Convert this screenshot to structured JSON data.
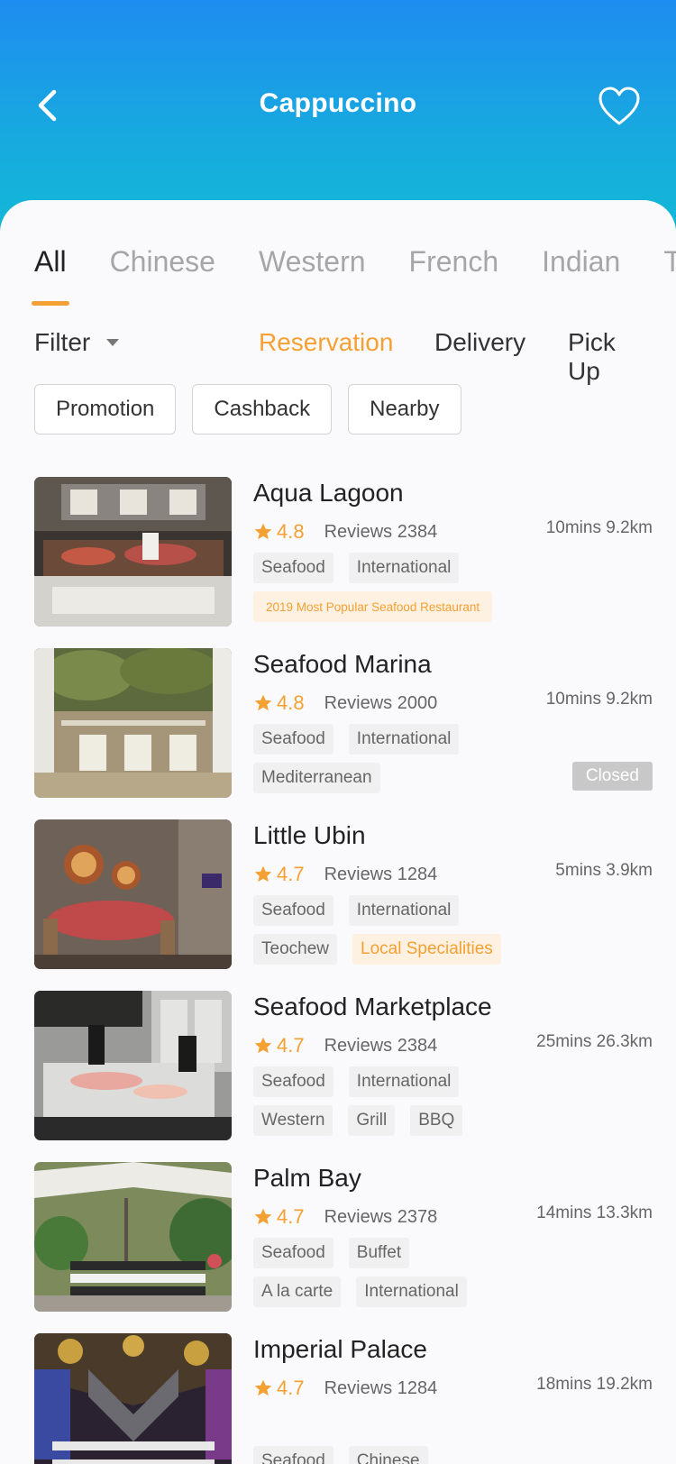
{
  "header": {
    "title": "Cappuccino"
  },
  "tabs": [
    "All",
    "Chinese",
    "Western",
    "French",
    "Indian",
    "Thai"
  ],
  "filter": {
    "label": "Filter"
  },
  "modes": [
    "Reservation",
    "Delivery",
    "Pick Up"
  ],
  "chips": [
    "Promotion",
    "Cashback",
    "Nearby"
  ],
  "restaurants": [
    {
      "name": "Aqua Lagoon",
      "rating": "4.8",
      "reviews": "Reviews 2384",
      "distance": "10mins  9.2km",
      "tags1": [
        "Seafood",
        "International"
      ],
      "tags2": [],
      "award": "2019 Most Popular Seafood Restaurant"
    },
    {
      "name": "Seafood Marina",
      "rating": "4.8",
      "reviews": "Reviews 2000",
      "distance": "10mins  9.2km",
      "tags1": [
        "Seafood",
        "International"
      ],
      "tags2": [
        "Mediterranean"
      ],
      "status": "Closed"
    },
    {
      "name": "Little Ubin",
      "rating": "4.7",
      "reviews": "Reviews 1284",
      "distance": "5mins 3.9km",
      "tags1": [
        "Seafood",
        "International"
      ],
      "tags2": [
        "Teochew"
      ],
      "highlight_tag": "Local Specialities"
    },
    {
      "name": "Seafood Marketplace",
      "rating": "4.7",
      "reviews": "Reviews 2384",
      "distance": "25mins  26.3km",
      "tags1": [
        "Seafood",
        "International"
      ],
      "tags2": [
        "Western",
        "Grill",
        "BBQ"
      ]
    },
    {
      "name": "Palm Bay",
      "rating": "4.7",
      "reviews": "Reviews 2378",
      "distance": "14mins  13.3km",
      "tags1": [
        "Seafood",
        "Buffet"
      ],
      "tags2": [
        "A la carte",
        "International"
      ]
    },
    {
      "name": "Imperial Palace",
      "rating": "4.7",
      "reviews": "Reviews 1284",
      "distance": "18mins  19.2km",
      "tags1": [
        "Seafood",
        "Chinese"
      ],
      "tags2": []
    }
  ],
  "colors": {
    "accent": "#f5a032",
    "header_top": "#1e8cf0",
    "header_bottom": "#12b9d6"
  }
}
